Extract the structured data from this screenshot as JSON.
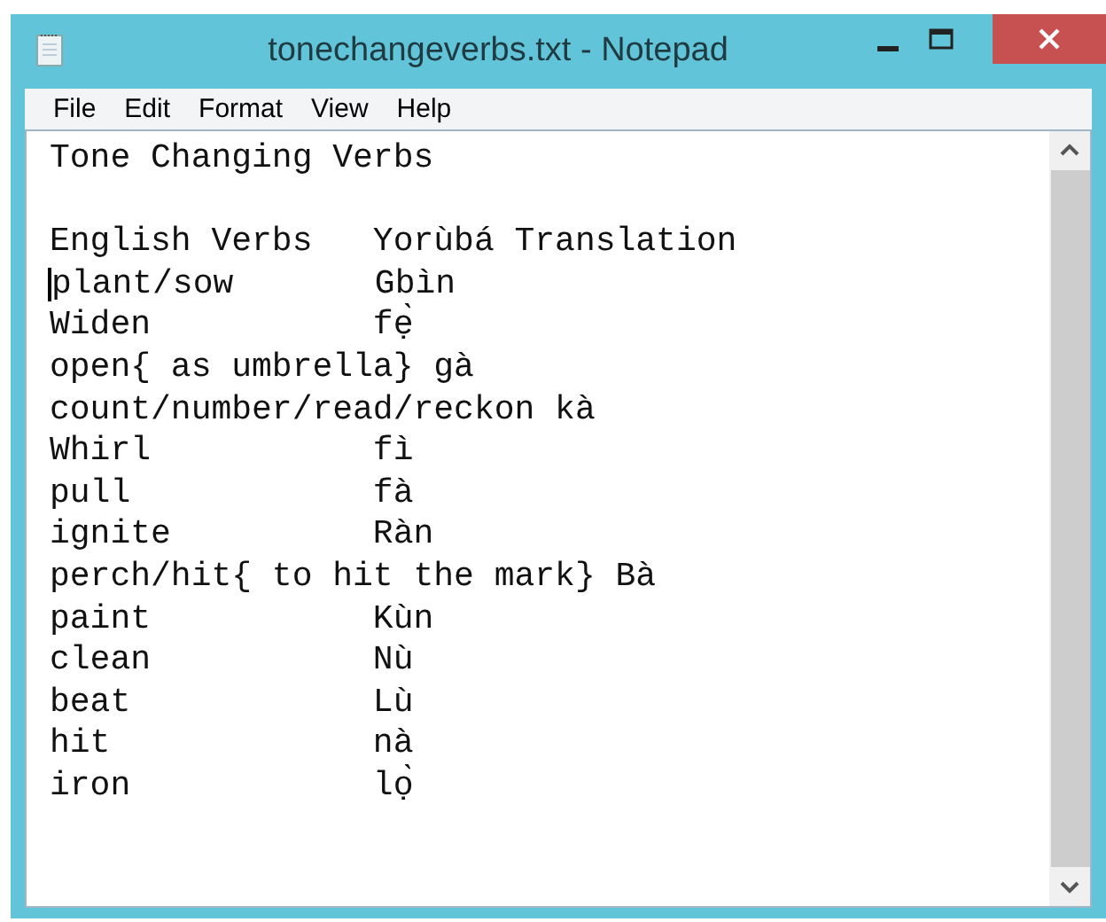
{
  "window": {
    "title": "tonechangeverbs.txt - Notepad"
  },
  "menu": [
    "File",
    "Edit",
    "Format",
    "View",
    "Help"
  ],
  "document": {
    "heading": "Tone Changing Verbs",
    "column_header": "English Verbs   Yorùbá Translation",
    "lines": [
      "plant/sow       Gbìn",
      "Widen           fẹ̀",
      "open{ as umbrella} gà",
      "count/number/read/reckon kà",
      "Whirl           fì",
      "pull            fà",
      "ignite          Ràn",
      "perch/hit{ to hit the mark} Bà",
      "paint           Kùn",
      "clean           Nù",
      "beat            Lù",
      "hit             nà",
      "iron            lọ̀"
    ]
  }
}
